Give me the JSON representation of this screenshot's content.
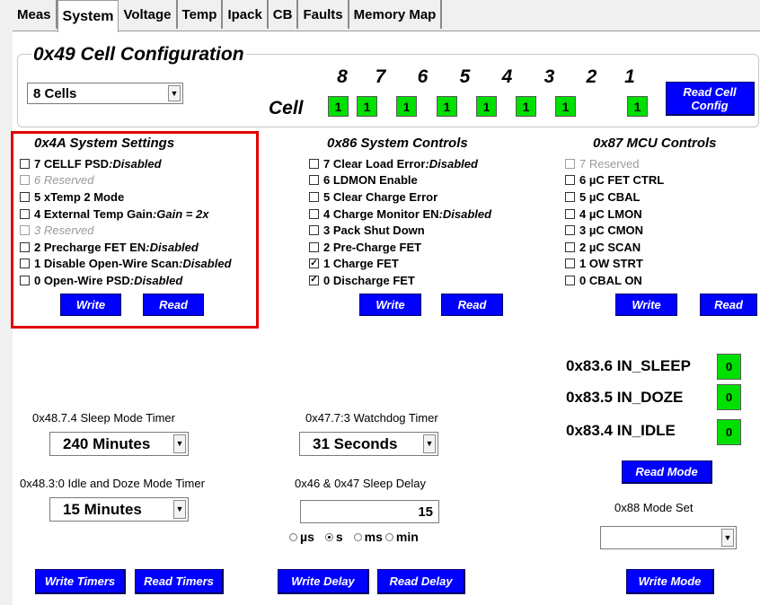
{
  "tabs": [
    "Meas",
    "System",
    "Voltage",
    "Temp",
    "Ipack",
    "CB",
    "Faults",
    "Memory Map"
  ],
  "active_tab": "System",
  "cell_config": {
    "title": "0x49 Cell Configuration",
    "cells_select": "8 Cells",
    "cell_label": "Cell",
    "cell_numbers": [
      "8",
      "7",
      "6",
      "5",
      "4",
      "3",
      "2",
      "1"
    ],
    "cell_values": [
      "1",
      "1",
      "1",
      "1",
      "1",
      "1",
      "1",
      "1"
    ],
    "read_button": "Read Cell Config",
    "cell_color": "#00e000"
  },
  "system_settings": {
    "title": "0x4A System Settings",
    "items": [
      {
        "label": "7 CELLF PSD ",
        "status": ":Disabled",
        "checked": false,
        "disabled": false
      },
      {
        "label": "6 Reserved",
        "status": "",
        "checked": false,
        "disabled": true
      },
      {
        "label": "5 xTemp 2 Mode",
        "status": "",
        "checked": false,
        "disabled": false
      },
      {
        "label": "4 External Temp Gain",
        "status": ":Gain = 2x",
        "checked": false,
        "disabled": false
      },
      {
        "label": "3 Reserved",
        "status": "",
        "checked": false,
        "disabled": true
      },
      {
        "label": "2 Precharge FET EN",
        "status": ":Disabled",
        "checked": false,
        "disabled": false
      },
      {
        "label": "1 Disable Open-Wire Scan ",
        "status": ":Disabled",
        "checked": false,
        "disabled": false
      },
      {
        "label": "0 Open-Wire PSD  ",
        "status": ":Disabled",
        "checked": false,
        "disabled": false
      }
    ],
    "write": "Write",
    "read": "Read",
    "highlight_color": "#e00000"
  },
  "system_controls": {
    "title": "0x86 System Controls",
    "items": [
      {
        "label": "7 Clear Load Error",
        "status": ":Disabled",
        "checked": false
      },
      {
        "label": "6 LDMON Enable",
        "status": "",
        "checked": false
      },
      {
        "label": "5 Clear Charge Error",
        "status": "",
        "checked": false
      },
      {
        "label": "4 Charge Monitor EN",
        "status": ":Disabled",
        "checked": false
      },
      {
        "label": "3 Pack Shut Down",
        "status": "",
        "checked": false
      },
      {
        "label": "2 Pre-Charge FET",
        "status": "",
        "checked": false
      },
      {
        "label": "1 Charge FET",
        "status": "",
        "checked": true
      },
      {
        "label": "0 Discharge FET",
        "status": "",
        "checked": true
      }
    ],
    "write": "Write",
    "read": "Read"
  },
  "mcu_controls": {
    "title": "0x87 MCU Controls",
    "items": [
      {
        "label": "7 Reserved",
        "checked": false,
        "disabled": true
      },
      {
        "label": "6 µC FET CTRL",
        "checked": false,
        "disabled": false
      },
      {
        "label": "5 µC CBAL",
        "checked": false,
        "disabled": false
      },
      {
        "label": "4 µC LMON",
        "checked": false,
        "disabled": false
      },
      {
        "label": "3 µC CMON",
        "checked": false,
        "disabled": false
      },
      {
        "label": "2 µC SCAN",
        "checked": false,
        "disabled": false
      },
      {
        "label": "1 OW STRT",
        "checked": false,
        "disabled": false
      },
      {
        "label": "0 CBAL ON",
        "checked": false,
        "disabled": false
      }
    ],
    "write": "Write",
    "read": "Read"
  },
  "mode_status": {
    "items": [
      {
        "label": "0x83.6 IN_SLEEP",
        "value": "0"
      },
      {
        "label": "0x83.5 IN_DOZE",
        "value": "0"
      },
      {
        "label": "0x83.4 IN_IDLE",
        "value": "0"
      }
    ],
    "read_mode": "Read Mode",
    "mode_set_label": "0x88 Mode Set",
    "mode_set_value": "",
    "write_mode": "Write Mode"
  },
  "timers": {
    "sleep_label": "0x48.7.4 Sleep Mode Timer",
    "sleep_value": "240 Minutes",
    "idle_label": "0x48.3:0 Idle and Doze Mode Timer",
    "idle_value": "15 Minutes",
    "watchdog_label": "0x47.7:3 Watchdog Timer",
    "watchdog_value": "31 Seconds",
    "write_timers": "Write Timers",
    "read_timers": "Read Timers"
  },
  "sleep_delay": {
    "label": "0x46 & 0x47 Sleep Delay",
    "value": "15",
    "units": [
      "µs",
      "s",
      "ms",
      "min"
    ],
    "selected_unit": "s",
    "write_delay": "Write Delay",
    "read_delay": "Read Delay"
  }
}
